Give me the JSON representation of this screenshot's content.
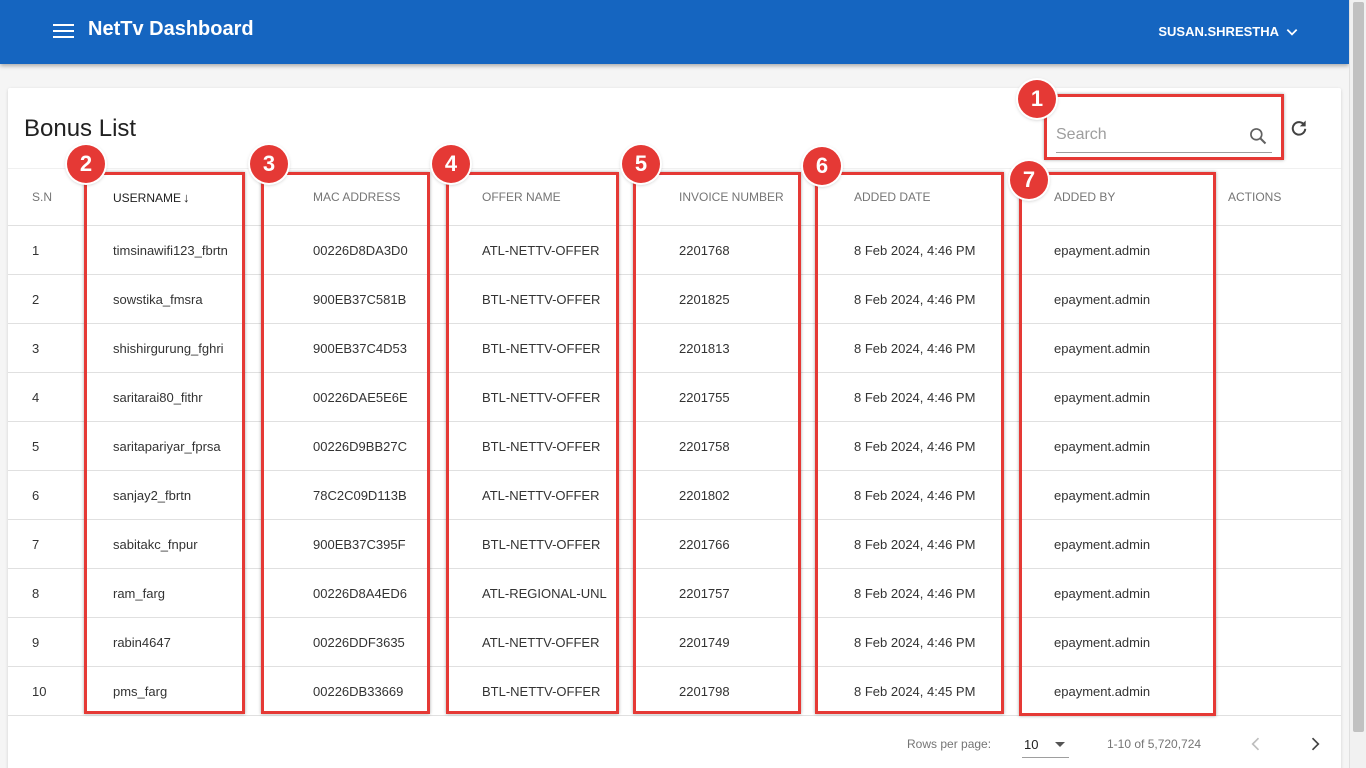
{
  "app": {
    "title": "NetTv Dashboard",
    "user": "SUSAN.SHRESTHA"
  },
  "page": {
    "title": "Bonus List"
  },
  "search": {
    "placeholder": "Search"
  },
  "table": {
    "headers": [
      "S.N",
      "USERNAME",
      "MAC ADDRESS",
      "OFFER NAME",
      "INVOICE NUMBER",
      "ADDED DATE",
      "ADDED BY",
      "ACTIONS"
    ],
    "sort_arrow": "↓",
    "rows": [
      [
        "1",
        "timsinawifi123_fbrtn",
        "00226D8DA3D0",
        "ATL-NETTV-OFFER",
        "2201768",
        "8 Feb 2024, 4:46 PM",
        "epayment.admin",
        ""
      ],
      [
        "2",
        "sowstika_fmsra",
        "900EB37C581B",
        "BTL-NETTV-OFFER",
        "2201825",
        "8 Feb 2024, 4:46 PM",
        "epayment.admin",
        ""
      ],
      [
        "3",
        "shishirgurung_fghri",
        "900EB37C4D53",
        "BTL-NETTV-OFFER",
        "2201813",
        "8 Feb 2024, 4:46 PM",
        "epayment.admin",
        ""
      ],
      [
        "4",
        "saritarai80_fithr",
        "00226DAE5E6E",
        "BTL-NETTV-OFFER",
        "2201755",
        "8 Feb 2024, 4:46 PM",
        "epayment.admin",
        ""
      ],
      [
        "5",
        "saritapariyar_fprsa",
        "00226D9BB27C",
        "BTL-NETTV-OFFER",
        "2201758",
        "8 Feb 2024, 4:46 PM",
        "epayment.admin",
        ""
      ],
      [
        "6",
        "sanjay2_fbrtn",
        "78C2C09D113B",
        "ATL-NETTV-OFFER",
        "2201802",
        "8 Feb 2024, 4:46 PM",
        "epayment.admin",
        ""
      ],
      [
        "7",
        "sabitakc_fnpur",
        "900EB37C395F",
        "BTL-NETTV-OFFER",
        "2201766",
        "8 Feb 2024, 4:46 PM",
        "epayment.admin",
        ""
      ],
      [
        "8",
        "ram_farg",
        "00226D8A4ED6",
        "ATL-REGIONAL-UNL",
        "2201757",
        "8 Feb 2024, 4:46 PM",
        "epayment.admin",
        ""
      ],
      [
        "9",
        "rabin4647",
        "00226DDF3635",
        "ATL-NETTV-OFFER",
        "2201749",
        "8 Feb 2024, 4:46 PM",
        "epayment.admin",
        ""
      ],
      [
        "10",
        "pms_farg",
        "00226DB33669",
        "BTL-NETTV-OFFER",
        "2201798",
        "8 Feb 2024, 4:45 PM",
        "epayment.admin",
        ""
      ]
    ]
  },
  "pagination": {
    "rows_per_page_label": "Rows per page:",
    "rows_per_page": "10",
    "range": "1-10 of 5,720,724"
  },
  "annotations": [
    "1",
    "2",
    "3",
    "4",
    "5",
    "6",
    "7"
  ],
  "colors": {
    "appbar": "#1565c0",
    "highlight": "#e53935"
  },
  "icons": [
    "menu-icon",
    "chevron-down-icon",
    "search-icon",
    "refresh-icon",
    "sort-arrow-icon",
    "chevron-left-icon",
    "chevron-right-icon"
  ]
}
